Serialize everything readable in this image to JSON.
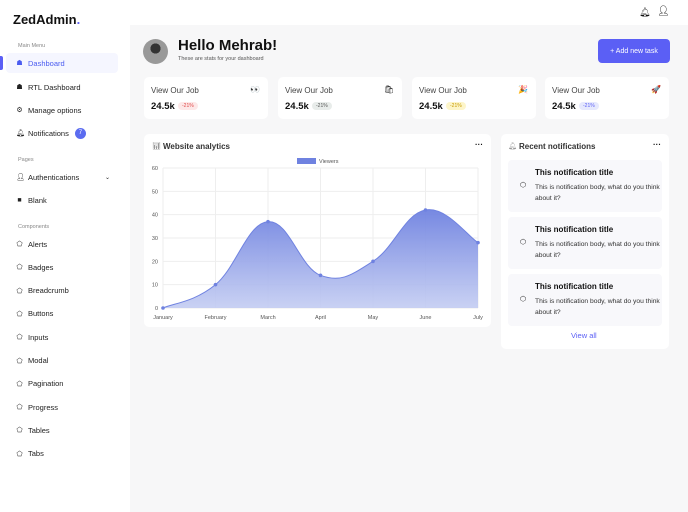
{
  "brand": {
    "name": "ZedAdmin",
    "dot": "."
  },
  "sidebar": {
    "main_menu": "Main Menu",
    "main_items": [
      {
        "label": "Dashboard",
        "icon": "dashboard-icon"
      },
      {
        "label": "RTL Dashboard",
        "icon": "dashboard-icon"
      },
      {
        "label": "Manage options",
        "icon": "gear-icon"
      },
      {
        "label": "Notifications",
        "icon": "bell-icon",
        "badge": "7"
      }
    ],
    "pages": "Pages",
    "page_items": [
      {
        "label": "Authentications",
        "icon": "user-icon"
      },
      {
        "label": "Blank",
        "icon": "square-icon"
      }
    ],
    "components": "Components",
    "component_items": [
      "Alerts",
      "Badges",
      "Breadcrumb",
      "Buttons",
      "Inputs",
      "Modal",
      "Pagination",
      "Progress",
      "Tables",
      "Tabs"
    ]
  },
  "header": {
    "greeting": "Hello Mehrab!",
    "subtitle": "These are stats for your dashboard",
    "add_button": "+ Add new task"
  },
  "stats": [
    {
      "title": "View Our Job",
      "value": "24.5k",
      "change": "-21%",
      "emoji": "👀",
      "bg": "#fde8e8",
      "fg": "#e04848"
    },
    {
      "title": "View Our Job",
      "value": "24.5k",
      "change": "-21%",
      "emoji": "🛍",
      "bg": "#e8ecea",
      "fg": "#555"
    },
    {
      "title": "View Our Job",
      "value": "24.5k",
      "change": "-21%",
      "emoji": "🎉",
      "bg": "#fdf5c9",
      "fg": "#c79a00"
    },
    {
      "title": "View Our Job",
      "value": "24.5k",
      "change": "-21%",
      "emoji": "🚀",
      "bg": "#e6e9fd",
      "fg": "#5b5ff5"
    }
  ],
  "analytics": {
    "title": "Website analytics",
    "more": "···"
  },
  "chart_data": {
    "type": "area",
    "title": "Website analytics",
    "categories": [
      "January",
      "February",
      "March",
      "April",
      "May",
      "June",
      "July"
    ],
    "series": [
      {
        "name": "Viewers",
        "values": [
          0,
          10,
          37,
          14,
          20,
          42,
          28
        ],
        "color": "#6f82e0"
      }
    ],
    "ylim": [
      0,
      60
    ],
    "yticks": [
      0,
      10,
      20,
      30,
      40,
      50,
      60
    ],
    "grid": true,
    "legend": "top"
  },
  "notifications": {
    "title": "Recent notifications",
    "more": "···",
    "items": [
      {
        "title": "This notification title",
        "body": "This is notification body, what do you think about it?"
      },
      {
        "title": "This notification title",
        "body": "This is notification body, what do you think about it?"
      },
      {
        "title": "This notification title",
        "body": "This is notification body, what do you think about it?"
      }
    ],
    "view_all": "View all"
  }
}
